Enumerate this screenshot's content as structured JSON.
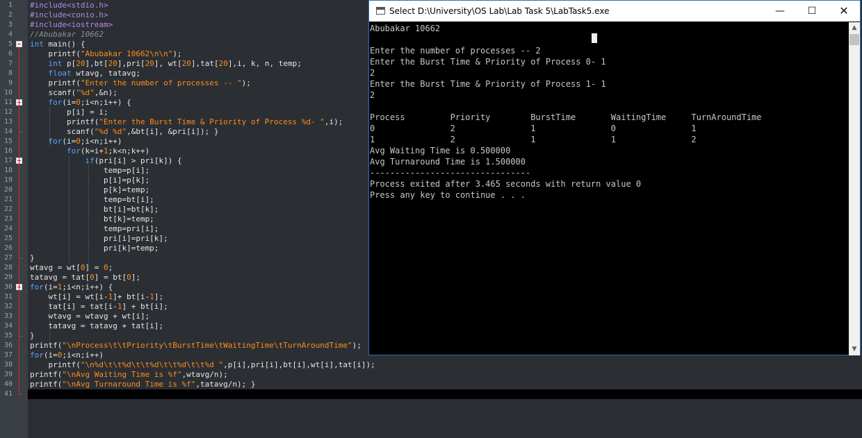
{
  "editor": {
    "line_numbers": [
      "1",
      "2",
      "3",
      "4",
      "5",
      "6",
      "7",
      "8",
      "9",
      "10",
      "11",
      "12",
      "13",
      "14",
      "15",
      "16",
      "17",
      "18",
      "19",
      "20",
      "21",
      "22",
      "23",
      "24",
      "25",
      "26",
      "27",
      "28",
      "29",
      "30",
      "31",
      "32",
      "33",
      "34",
      "35",
      "36",
      "37",
      "38",
      "39",
      "40",
      "41"
    ],
    "lines": [
      "#include<stdio.h>",
      "#include<conio.h>",
      "#include<iostream>",
      "//Abubakar 10662",
      "int main() {",
      "    printf(\"Abubakar 10662\\n\\n\");",
      "    int p[20],bt[20],pri[20], wt[20],tat[20],i, k, n, temp;",
      "    float wtavg, tatavg;",
      "    printf(\"Enter the number of processes -- \");",
      "    scanf(\"%d\",&n);",
      "    for(i=0;i<n;i++) {",
      "        p[i] = i;",
      "        printf(\"Enter the Burst Time & Priority of Process %d- \",i);",
      "        scanf(\"%d %d\",&bt[i], &pri[i]); }",
      "    for(i=0;i<n;i++)",
      "        for(k=i+1;k<n;k++)",
      "            if(pri[i] > pri[k]) {",
      "                temp=p[i];",
      "                p[i]=p[k];",
      "                p[k]=temp;",
      "                temp=bt[i];",
      "                bt[i]=bt[k];",
      "                bt[k]=temp;",
      "                temp=pri[i];",
      "                pri[i]=pri[k];",
      "                pri[k]=temp;",
      "}",
      "wtavg = wt[0] = 0;",
      "tatavg = tat[0] = bt[0];",
      "for(i=1;i<n;i++) {",
      "    wt[i] = wt[i-1]+ bt[i-1];",
      "    tat[i] = tat[i-1] + bt[i];",
      "    wtavg = wtavg + wt[i];",
      "    tatavg = tatavg + tat[i];",
      "}",
      "printf(\"\\nProcess\\t\\tPriority\\tBurstTime\\tWaitingTime\\tTurnAroundTime\");",
      "for(i=0;i<n;i++)",
      "    printf(\"\\n%d\\t\\t%d\\t\\t%d\\t\\t%d\\t\\t%d \",p[i],pri[i],bt[i],wt[i],tat[i]);",
      "printf(\"\\nAvg Waiting Time is %f\",wtavg/n);",
      "printf(\"\\nAvg Turnaround Time is %f\",tatavg/n); }",
      ""
    ]
  },
  "console_window": {
    "title": "Select D:\\University\\OS Lab\\Lab Task 5\\LabTask5.exe",
    "minimize": "—",
    "maximize": "☐",
    "close": "✕",
    "scroll_up": "▲",
    "scroll_down": "▼",
    "output": [
      "Abubakar 10662",
      "",
      "Enter the number of processes -- 2",
      "Enter the Burst Time & Priority of Process 0- 1",
      "2",
      "Enter the Burst Time & Priority of Process 1- 1",
      "2",
      "",
      "Process         Priority        BurstTime       WaitingTime     TurnAroundTime",
      "0               2               1               0               1",
      "1               2               1               1               2",
      "Avg Waiting Time is 0.500000",
      "Avg Turnaround Time is 1.500000",
      "--------------------------------",
      "Process exited after 3.465 seconds with return value 0",
      "Press any key to continue . . ."
    ]
  }
}
